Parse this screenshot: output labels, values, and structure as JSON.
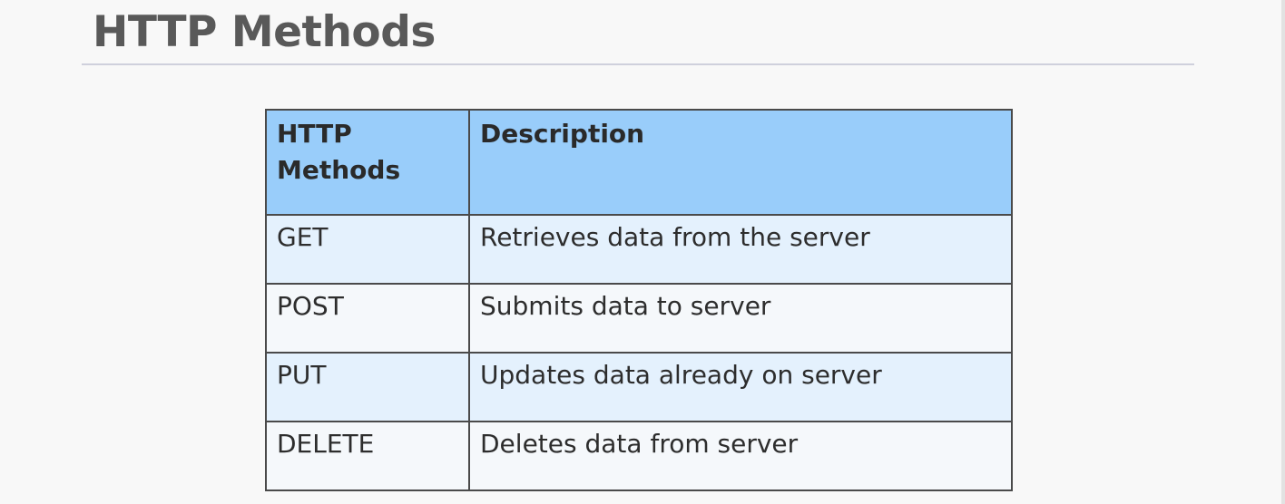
{
  "slide": {
    "title": "HTTP Methods"
  },
  "table": {
    "headers": [
      "HTTP Methods",
      "Description"
    ],
    "rows": [
      {
        "method": "GET",
        "description": "Retrieves data from the server"
      },
      {
        "method": "POST",
        "description": "Submits data to server"
      },
      {
        "method": "PUT",
        "description": "Updates data already  on server"
      },
      {
        "method": "DELETE",
        "description": "Deletes data from server"
      }
    ]
  },
  "colors": {
    "header_background": "#99cdfa",
    "row_background_light_blue": "#e4f1fd",
    "row_background_pale": "#f5f8fb",
    "title_text": "#595959"
  }
}
